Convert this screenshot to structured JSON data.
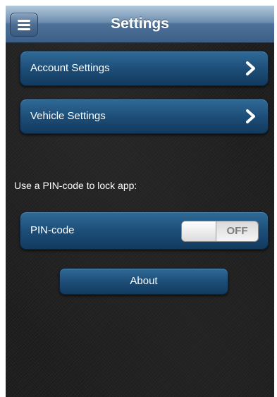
{
  "header": {
    "title": "Settings",
    "menu_icon": "hamburger-menu-icon"
  },
  "rows": [
    {
      "label": "Account Settings",
      "icon": "chevron-right-icon"
    },
    {
      "label": "Vehicle Settings",
      "icon": "chevron-right-icon"
    }
  ],
  "pin": {
    "hint": "Use a PIN-code to lock app:",
    "label": "PIN-code",
    "toggle_state": "OFF"
  },
  "about": {
    "label": "About"
  },
  "colors": {
    "navbar": "#4d7198",
    "button": "#1c4c76",
    "background": "#1e1e1e",
    "text": "#ffffff"
  }
}
